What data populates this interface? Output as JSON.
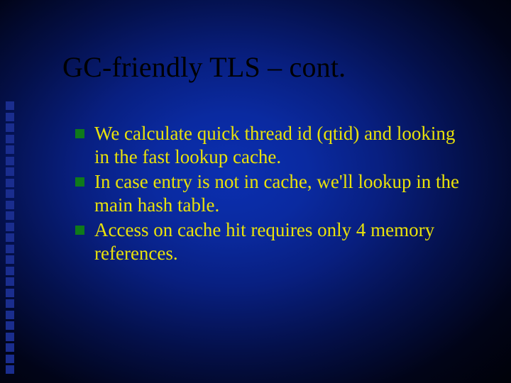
{
  "slide": {
    "title": "GC-friendly TLS – cont.",
    "bullets": [
      "We calculate quick thread id (qtid) and looking in the fast lookup cache.",
      "In case entry is not in cache, we'll lookup in the main hash table.",
      "Access on cache hit requires only 4 memory references."
    ]
  }
}
